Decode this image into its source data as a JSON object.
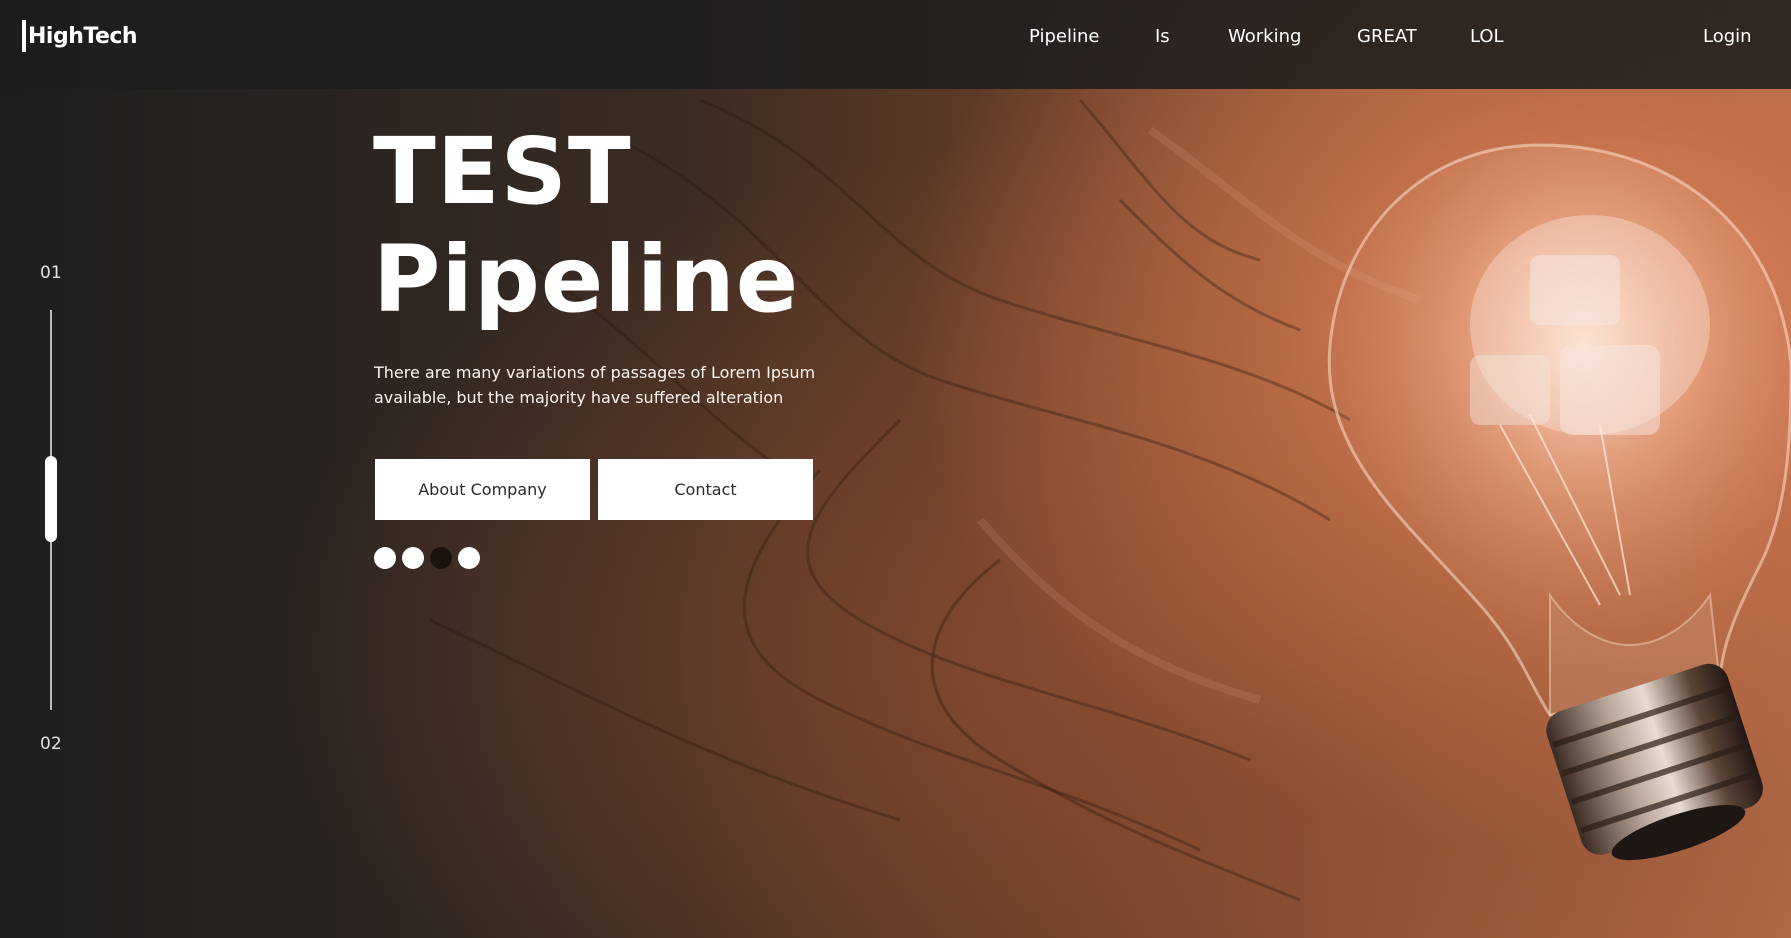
{
  "brand": {
    "name": "HighTech"
  },
  "nav": {
    "links": [
      "Pipeline",
      "Is",
      "Working",
      "GREAT",
      "LOL"
    ],
    "login_label": "Login"
  },
  "slider": {
    "start_label": "01",
    "end_label": "02",
    "dots_total": 4,
    "active_dot": 3
  },
  "hero": {
    "title_line1": "TEST",
    "title_line2": "Pipeline",
    "description": "There are many variations of passages of Lorem Ipsum available, but the majority have suffered alteration",
    "buttons": {
      "about_label": "About Company",
      "contact_label": "Contact"
    }
  },
  "colors": {
    "nav_bg": "#1e1e1e",
    "button_bg": "#ffffff",
    "button_text": "#2a2a2a",
    "active_dot": "#1b120c",
    "accent_wood": "#b46a48"
  },
  "icons": [
    "lightbulb-image"
  ]
}
